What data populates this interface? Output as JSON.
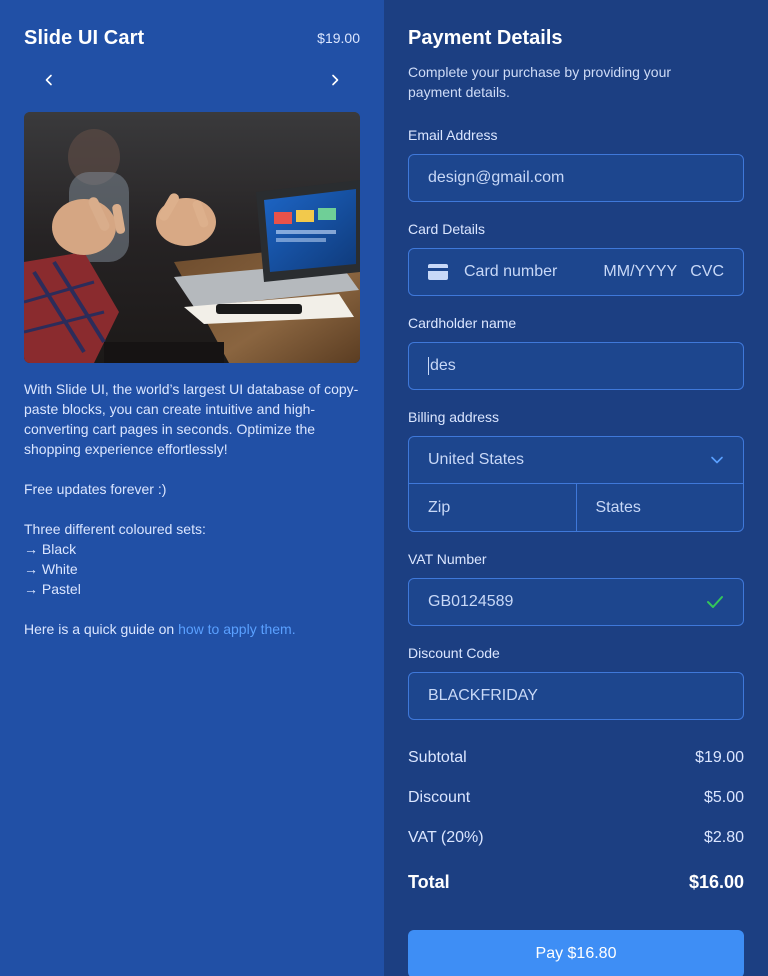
{
  "left": {
    "title": "Slide UI Cart",
    "price": "$19.00",
    "desc_p1": "With Slide UI, the world’s largest UI database of copy-paste blocks, you can create intuitive and high-converting cart pages in seconds. Optimize the shopping experience effortlessly!",
    "desc_p2": "Free updates forever :)",
    "sets_heading": "Three different coloured sets:",
    "sets": [
      "→ Black",
      "→ White",
      "→ Pastel"
    ],
    "guide_text": "Here is a quick guide on ",
    "guide_link": "how to apply them."
  },
  "right": {
    "title": "Payment Details",
    "subtitle": "Complete your purchase by providing your payment details.",
    "email_label": "Email Address",
    "email_value": "design@gmail.com",
    "card_label": "Card Details",
    "card_number_placeholder": "Card number",
    "card_expiry_placeholder": "MM/YYYY",
    "card_cvc_placeholder": "CVC",
    "cardholder_label": "Cardholder name",
    "cardholder_value": "des",
    "billing_label": "Billing address",
    "country_value": "United States",
    "zip_placeholder": "Zip",
    "state_placeholder": "States",
    "vat_label": "VAT Number",
    "vat_value": "GB0124589",
    "discount_label": "Discount Code",
    "discount_value": "BLACKFRIDAY",
    "subtotal_label": "Subtotal",
    "subtotal_value": "$19.00",
    "discount_row_label": "Discount",
    "discount_row_value": "$5.00",
    "vat_row_label": "VAT (20%)",
    "vat_row_value": "$2.80",
    "total_label": "Total",
    "total_value": "$16.00",
    "pay_label": "Pay $16.80"
  },
  "icons": {
    "prev": "chevron-left-icon",
    "next": "chevron-right-icon",
    "card": "credit-card-icon",
    "select": "chevron-down-icon",
    "valid": "check-icon"
  },
  "colors": {
    "left_bg": "#2150a6",
    "right_bg": "#1c3f82",
    "accent": "#3e8ef5",
    "link": "#5aa0ff",
    "valid": "#34c759"
  }
}
